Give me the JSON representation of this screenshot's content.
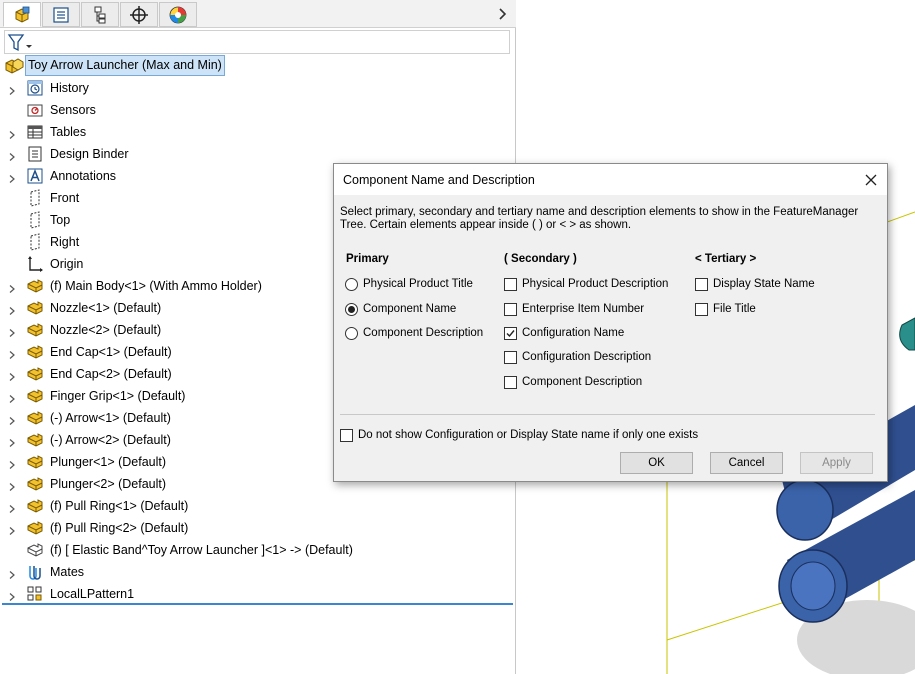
{
  "tabs": [
    {
      "icon": "feature-manager-icon",
      "active": true
    },
    {
      "icon": "property-manager-icon",
      "active": false
    },
    {
      "icon": "configuration-manager-icon",
      "active": false
    },
    {
      "icon": "dimxpert-icon",
      "active": false
    },
    {
      "icon": "display-manager-icon",
      "active": false
    }
  ],
  "tree": {
    "root_label": "Toy Arrow Launcher (Max and Min)",
    "items": [
      {
        "label": "History",
        "icon": "history-icon",
        "expandable": true
      },
      {
        "label": "Sensors",
        "icon": "sensors-icon",
        "expandable": false
      },
      {
        "label": "Tables",
        "icon": "tables-icon",
        "expandable": true
      },
      {
        "label": "Design Binder",
        "icon": "design-binder-icon",
        "expandable": true
      },
      {
        "label": "Annotations",
        "icon": "annotations-icon",
        "expandable": true
      },
      {
        "label": "Front",
        "icon": "plane-icon",
        "expandable": false
      },
      {
        "label": "Top",
        "icon": "plane-icon",
        "expandable": false
      },
      {
        "label": "Right",
        "icon": "plane-icon",
        "expandable": false
      },
      {
        "label": "Origin",
        "icon": "origin-icon",
        "expandable": false
      },
      {
        "label": "(f) Main Body<1> (With Ammo Holder)",
        "icon": "part-icon",
        "expandable": true
      },
      {
        "label": "Nozzle<1> (Default)",
        "icon": "part-icon",
        "expandable": true
      },
      {
        "label": "Nozzle<2> (Default)",
        "icon": "part-icon",
        "expandable": true
      },
      {
        "label": "End Cap<1> (Default)",
        "icon": "part-icon",
        "expandable": true
      },
      {
        "label": "End Cap<2> (Default)",
        "icon": "part-icon",
        "expandable": true
      },
      {
        "label": "Finger Grip<1> (Default)",
        "icon": "part-icon",
        "expandable": true
      },
      {
        "label": "(-) Arrow<1> (Default)",
        "icon": "part-icon",
        "expandable": true
      },
      {
        "label": "(-) Arrow<2> (Default)",
        "icon": "part-icon",
        "expandable": true
      },
      {
        "label": "Plunger<1> (Default)",
        "icon": "part-icon",
        "expandable": true
      },
      {
        "label": "Plunger<2> (Default)",
        "icon": "part-icon",
        "expandable": true
      },
      {
        "label": "(f) Pull Ring<1> (Default)",
        "icon": "part-icon",
        "expandable": true
      },
      {
        "label": "(f) Pull Ring<2> (Default)",
        "icon": "part-icon",
        "expandable": true
      },
      {
        "label": "(f) [ Elastic Band^Toy Arrow Launcher ]<1> -> (Default)",
        "icon": "virtual-part-icon",
        "expandable": false
      },
      {
        "label": "Mates",
        "icon": "mates-icon",
        "expandable": true
      },
      {
        "label": "LocalLPattern1",
        "icon": "pattern-icon",
        "expandable": true
      }
    ]
  },
  "dialog": {
    "title": "Component Name and Description",
    "description": "Select primary, secondary and tertiary name and description elements to show in the FeatureManager Tree. Certain elements appear inside ( ) or < > as shown.",
    "primary": {
      "header": "Primary",
      "options": [
        {
          "label": "Physical Product Title",
          "selected": false
        },
        {
          "label": "Component Name",
          "selected": true
        },
        {
          "label": "Component Description",
          "selected": false
        }
      ]
    },
    "secondary": {
      "header": "( Secondary )",
      "options": [
        {
          "label": "Physical Product Description",
          "checked": false
        },
        {
          "label": "Enterprise Item Number",
          "checked": false
        },
        {
          "label": "Configuration Name",
          "checked": true
        },
        {
          "label": "Configuration Description",
          "checked": false
        },
        {
          "label": "Component Description",
          "checked": false
        }
      ]
    },
    "tertiary": {
      "header": "< Tertiary >",
      "options": [
        {
          "label": "Display State Name",
          "checked": false
        },
        {
          "label": "File Title",
          "checked": false
        }
      ]
    },
    "footer_checkbox": {
      "label": "Do not show Configuration or Display State name if only one exists",
      "checked": false
    },
    "buttons": {
      "ok": "OK",
      "cancel": "Cancel",
      "apply": "Apply"
    }
  },
  "colors": {
    "selection_bg": "#cde3f7",
    "part_yellow": "#f2c12e",
    "model_blue": "#2f4f8f",
    "model_teal": "#2a8f8a",
    "bbox_yellow": "#c8c400"
  }
}
